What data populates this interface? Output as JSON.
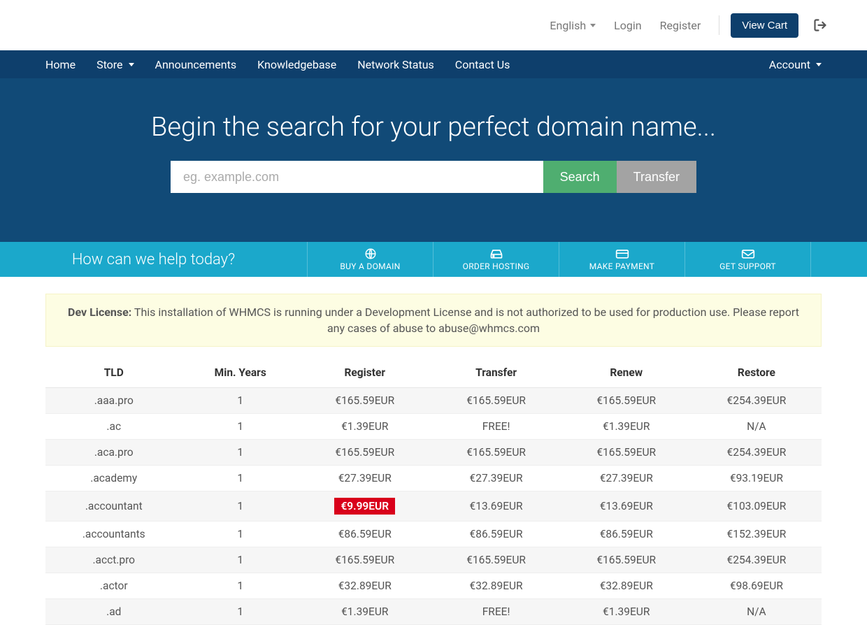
{
  "topbar": {
    "language": "English",
    "login": "Login",
    "register": "Register",
    "view_cart": "View Cart"
  },
  "nav": {
    "items": [
      "Home",
      "Store",
      "Announcements",
      "Knowledgebase",
      "Network Status",
      "Contact Us"
    ],
    "account": "Account"
  },
  "hero": {
    "title": "Begin the search for your perfect domain name...",
    "placeholder": "eg. example.com",
    "search": "Search",
    "transfer": "Transfer"
  },
  "help": {
    "question": "How can we help today?",
    "buy": "BUY A DOMAIN",
    "order": "ORDER HOSTING",
    "pay": "MAKE PAYMENT",
    "support": "GET SUPPORT"
  },
  "alert": {
    "prefix": "Dev License:",
    "text": " This installation of WHMCS is running under a Development License and is not authorized to be used for production use. Please report any cases of abuse to abuse@whmcs.com"
  },
  "table": {
    "headers": [
      "TLD",
      "Min. Years",
      "Register",
      "Transfer",
      "Renew",
      "Restore"
    ],
    "rows": [
      {
        "tld": ".aaa.pro",
        "years": "1",
        "register": "€165.59EUR",
        "transfer": "€165.59EUR",
        "renew": "€165.59EUR",
        "restore": "€254.39EUR",
        "highlight": false
      },
      {
        "tld": ".ac",
        "years": "1",
        "register": "€1.39EUR",
        "transfer": "FREE!",
        "renew": "€1.39EUR",
        "restore": "N/A",
        "highlight": false
      },
      {
        "tld": ".aca.pro",
        "years": "1",
        "register": "€165.59EUR",
        "transfer": "€165.59EUR",
        "renew": "€165.59EUR",
        "restore": "€254.39EUR",
        "highlight": false
      },
      {
        "tld": ".academy",
        "years": "1",
        "register": "€27.39EUR",
        "transfer": "€27.39EUR",
        "renew": "€27.39EUR",
        "restore": "€93.19EUR",
        "highlight": false
      },
      {
        "tld": ".accountant",
        "years": "1",
        "register": "€9.99EUR",
        "transfer": "€13.69EUR",
        "renew": "€13.69EUR",
        "restore": "€103.09EUR",
        "highlight": true
      },
      {
        "tld": ".accountants",
        "years": "1",
        "register": "€86.59EUR",
        "transfer": "€86.59EUR",
        "renew": "€86.59EUR",
        "restore": "€152.39EUR",
        "highlight": false
      },
      {
        "tld": ".acct.pro",
        "years": "1",
        "register": "€165.59EUR",
        "transfer": "€165.59EUR",
        "renew": "€165.59EUR",
        "restore": "€254.39EUR",
        "highlight": false
      },
      {
        "tld": ".actor",
        "years": "1",
        "register": "€32.89EUR",
        "transfer": "€32.89EUR",
        "renew": "€32.89EUR",
        "restore": "€98.69EUR",
        "highlight": false
      },
      {
        "tld": ".ad",
        "years": "1",
        "register": "€1.39EUR",
        "transfer": "FREE!",
        "renew": "€1.39EUR",
        "restore": "N/A",
        "highlight": false
      }
    ]
  }
}
